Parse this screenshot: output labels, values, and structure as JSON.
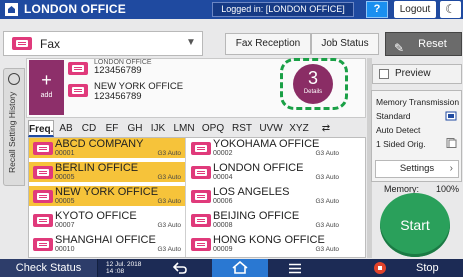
{
  "titlebar": {
    "title": "LONDON OFFICE",
    "login": "Logged in: [LONDON OFFICE]",
    "help": "?",
    "logout": "Logout",
    "moon": "☾"
  },
  "app": {
    "selected": "Fax"
  },
  "toolbar": {
    "fax_reception": "Fax Reception",
    "job_status": "Job Status",
    "reset": "Reset"
  },
  "recall_tab": "Recall Setting History",
  "destinations": {
    "add_label": "add",
    "entries": [
      {
        "name": "LONDON OFFICE",
        "number": "123456789"
      },
      {
        "name": "NEW YORK OFFICE",
        "number": "123456789"
      }
    ],
    "details": {
      "count": "3",
      "label": "Details"
    }
  },
  "index_tabs": [
    "Freq.",
    "AB",
    "CD",
    "EF",
    "GH",
    "IJK",
    "LMN",
    "OPQ",
    "RST",
    "UVW",
    "XYZ",
    "⇄"
  ],
  "address_book": [
    {
      "name": "ABCD COMPANY",
      "number": "00001",
      "mode": "G3 Auto",
      "selected": true
    },
    {
      "name": "YOKOHAMA OFFICE",
      "number": "00002",
      "mode": "G3 Auto",
      "selected": false
    },
    {
      "name": "BERLIN OFFICE",
      "number": "00005",
      "mode": "G3 Auto",
      "selected": true
    },
    {
      "name": "LONDON OFFICE",
      "number": "00004",
      "mode": "G3 Auto",
      "selected": false
    },
    {
      "name": "NEW YORK OFFICE",
      "number": "00005",
      "mode": "G3 Auto",
      "selected": true
    },
    {
      "name": "LOS ANGELES",
      "number": "00006",
      "mode": "G3 Auto",
      "selected": false
    },
    {
      "name": "KYOTO OFFICE",
      "number": "00007",
      "mode": "G3 Auto",
      "selected": false
    },
    {
      "name": "BEIJING OFFICE",
      "number": "00008",
      "mode": "G3 Auto",
      "selected": false
    },
    {
      "name": "SHANGHAI OFFICE",
      "number": "00010",
      "mode": "G3 Auto",
      "selected": false
    },
    {
      "name": "HONG KONG OFFICE",
      "number": "00009",
      "mode": "G3 Auto",
      "selected": false
    }
  ],
  "right_panel": {
    "preview": "Preview",
    "lines": [
      "Memory Transmission",
      "Standard",
      "Auto Detect",
      "1 Sided Orig."
    ],
    "settings": "Settings",
    "memory_label": "Memory:",
    "memory_value": "100%",
    "start": "Start"
  },
  "bottombar": {
    "check_status": "Check Status",
    "date": "12 Jul. 2018",
    "time": "14 :08",
    "stop": "Stop"
  },
  "colors": {
    "title_bar": "#1f4aa0",
    "fax_accent": "#e03a7b",
    "selected_row": "#f6c33a",
    "start_button": "#2aa05b",
    "details_highlight": "#1aa046"
  }
}
